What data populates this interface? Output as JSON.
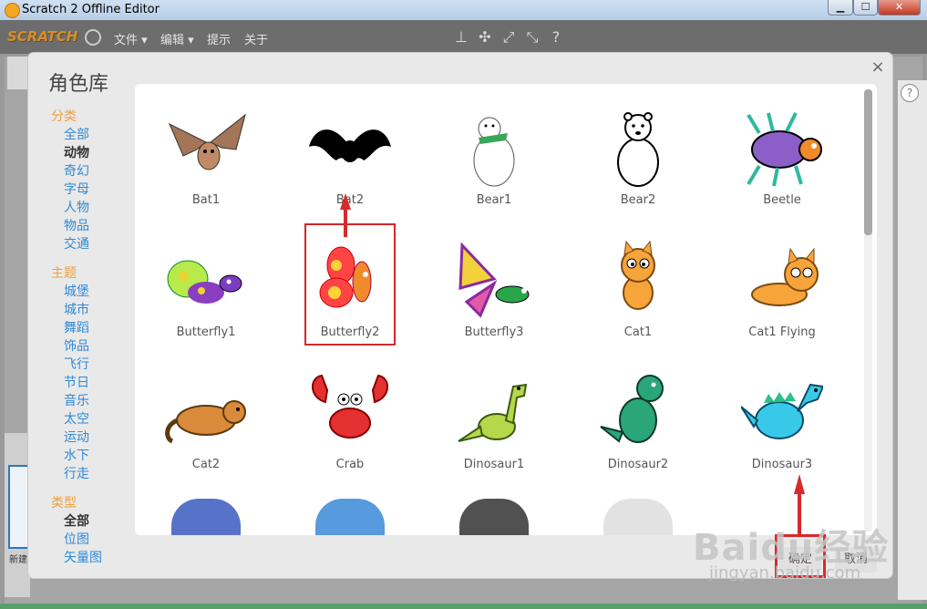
{
  "window": {
    "title": "Scratch 2 Offline Editor",
    "minimize": "▁",
    "maximize": "☐",
    "close": "✕"
  },
  "menubar": {
    "logo": "SCRATCH",
    "items": [
      "文件 ▾",
      "编辑 ▾",
      "提示",
      "关于"
    ],
    "tool_icons": [
      "stamp-icon",
      "cut-icon",
      "grow-icon",
      "shrink-icon",
      "help-icon"
    ]
  },
  "background": {
    "new_sprite_label": "新建",
    "help": "?"
  },
  "dialog": {
    "title": "角色库",
    "close": "×",
    "filters": {
      "category_heading": "分类",
      "categories": [
        "全部",
        "动物",
        "奇幻",
        "字母",
        "人物",
        "物品",
        "交通"
      ],
      "selected_category": "动物",
      "theme_heading": "主题",
      "themes": [
        "城堡",
        "城市",
        "舞蹈",
        "饰品",
        "飞行",
        "节日",
        "音乐",
        "太空",
        "运动",
        "水下",
        "行走"
      ],
      "type_heading": "类型",
      "types": [
        "全部",
        "位图",
        "矢量图"
      ],
      "selected_type": "全部"
    },
    "sprites": [
      {
        "name": "Bat1",
        "icon": "bat1"
      },
      {
        "name": "Bat2",
        "icon": "bat2"
      },
      {
        "name": "Bear1",
        "icon": "bear1"
      },
      {
        "name": "Bear2",
        "icon": "bear2"
      },
      {
        "name": "Beetle",
        "icon": "beetle"
      },
      {
        "name": "Butterfly1",
        "icon": "butterfly1"
      },
      {
        "name": "Butterfly2",
        "icon": "butterfly2"
      },
      {
        "name": "Butterfly3",
        "icon": "butterfly3"
      },
      {
        "name": "Cat1",
        "icon": "cat1"
      },
      {
        "name": "Cat1 Flying",
        "icon": "cat1-flying"
      },
      {
        "name": "Cat2",
        "icon": "cat2"
      },
      {
        "name": "Crab",
        "icon": "crab"
      },
      {
        "name": "Dinosaur1",
        "icon": "dinosaur1"
      },
      {
        "name": "Dinosaur2",
        "icon": "dinosaur2"
      },
      {
        "name": "Dinosaur3",
        "icon": "dinosaur3"
      }
    ],
    "selected_sprite": "Butterfly2",
    "ok_label": "确定",
    "cancel_label": "取消"
  },
  "watermark": {
    "brand": "Baidu经验",
    "url": "jingyan.baidu.com"
  },
  "colors": {
    "accent_orange": "#f0a03a",
    "link_blue": "#2f8ad8",
    "highlight_red": "#d82a2a"
  }
}
